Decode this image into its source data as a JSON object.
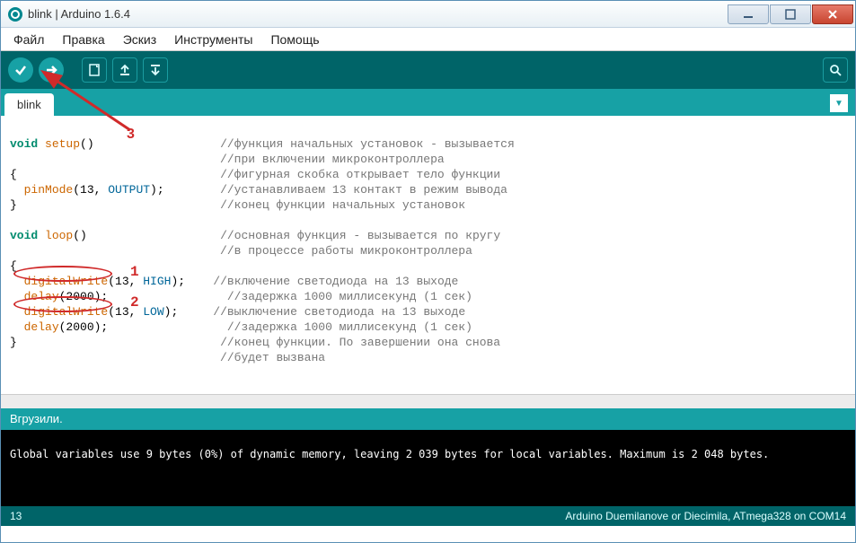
{
  "window": {
    "title": "blink | Arduino 1.6.4"
  },
  "menu": {
    "file": "Файл",
    "edit": "Правка",
    "sketch": "Эскиз",
    "tools": "Инструменты",
    "help": "Помощь"
  },
  "toolbar": {
    "verify_title": "Verify",
    "upload_title": "Upload",
    "new_title": "New",
    "open_title": "Open",
    "save_title": "Save",
    "serial_title": "Serial Monitor"
  },
  "tabs": {
    "active": "blink"
  },
  "code": {
    "l1_a": "void",
    "l1_b": " ",
    "l1_c": "setup",
    "l1_d": "()",
    "l1_cm": "//функция начальных установок - вызывается",
    "l2_cm": "//при включении микроконтроллера",
    "l3_a": "{",
    "l3_cm": "//фигурная скобка открывает тело функции",
    "l4_a": "  ",
    "l4_b": "pinMode",
    "l4_c": "(13, ",
    "l4_d": "OUTPUT",
    "l4_e": ");",
    "l4_cm": "//устанавливаем 13 контакт в режим вывода",
    "l5_a": "}",
    "l5_cm": "//конец функции начальных установок",
    "l7_a": "void",
    "l7_b": " ",
    "l7_c": "loop",
    "l7_d": "()",
    "l7_cm": "//основная функция - вызывается по кругу",
    "l8_cm": "//в процессе работы микроконтроллера",
    "l9_a": "{",
    "l10_a": "  ",
    "l10_b": "digitalWrite",
    "l10_c": "(13, ",
    "l10_d": "HIGH",
    "l10_e": ");",
    "l10_cm": "//включение светодиода на 13 выходе",
    "l11_a": "  ",
    "l11_b": "delay",
    "l11_c": "(2000);",
    "l11_cm": "//задержка 1000 миллисекунд (1 сек)",
    "l12_a": "  ",
    "l12_b": "digitalWrite",
    "l12_c": "(13, ",
    "l12_d": "LOW",
    "l12_e": ");",
    "l12_cm": "//выключение светодиода на 13 выходе",
    "l13_a": "  ",
    "l13_b": "delay",
    "l13_c": "(2000);",
    "l13_cm": "//задержка 1000 миллисекунд (1 сек)",
    "l14_a": "}",
    "l14_cm": "//конец функции. По завершении она снова",
    "l15_cm": "//будет вызвана"
  },
  "status": {
    "text": "Вгрузили."
  },
  "console": {
    "line": "Global variables use 9 bytes (0%) of dynamic memory, leaving 2 039 bytes for local variables. Maximum is 2 048 bytes."
  },
  "footer": {
    "line": "13",
    "board": "Arduino Duemilanove or Diecimila, ATmega328 on COM14"
  },
  "annotations": {
    "n1": "1",
    "n2": "2",
    "n3": "3"
  }
}
